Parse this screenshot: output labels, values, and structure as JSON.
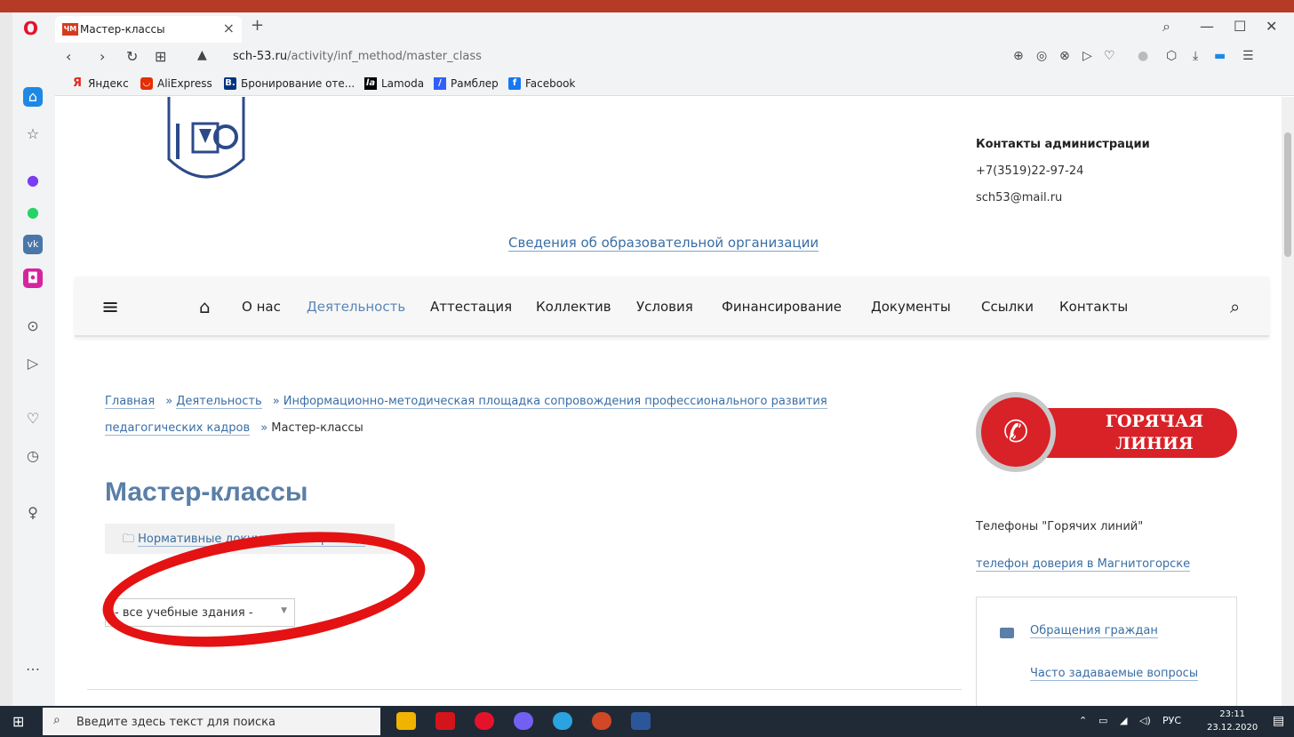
{
  "browser": {
    "tab_title": "Мастер-классы",
    "tab_favicon_text": "ЧМ",
    "url_host": "sch-53.ru",
    "url_path": "/activity/inf_method/master_class",
    "bookmarks": [
      {
        "label": "Яндекс",
        "icon": "yandex-icon",
        "color": "#e52620"
      },
      {
        "label": "AliExpress",
        "icon": "aliexpress-icon",
        "color": "#e62e04"
      },
      {
        "label": "Бронирование оте...",
        "icon": "booking-icon",
        "color": "#003580"
      },
      {
        "label": "Lamoda",
        "icon": "lamoda-icon",
        "color": "#000000"
      },
      {
        "label": "Рамблер",
        "icon": "rambler-icon",
        "color": "#315efb"
      },
      {
        "label": "Facebook",
        "icon": "facebook-icon",
        "color": "#1877f2"
      }
    ]
  },
  "header": {
    "contacts_title": "Контакты администрации",
    "phone": "+7(3519)22-97-24",
    "email": "sch53@mail.ru",
    "info_link": "Сведения об образовательной организации"
  },
  "menu": {
    "items": [
      "О нас",
      "Деятельность",
      "Аттестация",
      "Коллектив",
      "Условия",
      "Финансирование",
      "Документы",
      "Ссылки",
      "Контакты"
    ],
    "active": "Деятельность"
  },
  "breadcrumb": {
    "home": "Главная",
    "activity": "Деятельность",
    "platform": "Информационно-методическая площадка сопровождения профессионального развития педагогических кадров",
    "current": "Мастер-классы",
    "separator": "»"
  },
  "main": {
    "title": "Мастер-классы",
    "normdocs_link": "Нормативные документы к странице",
    "building_select": "- все учебные здания -"
  },
  "aside": {
    "hotline_text_1": "ГОРЯЧАЯ",
    "hotline_text_2": "ЛИНИЯ",
    "hot_phones": "Телефоны \"Горячих линий\"",
    "trust_link": "телефон доверия в Магнитогорске",
    "appeals_link": "Обращения граждан",
    "faq_link": "Часто задаваемые вопросы"
  },
  "taskbar": {
    "search_placeholder": "Введите здесь текст для поиска",
    "lang": "РУС",
    "time": "23:11",
    "date": "23.12.2020"
  },
  "colors": {
    "accent_link": "#3a6ea5",
    "annotation": "#e41212",
    "hotline_red": "#d92128"
  }
}
